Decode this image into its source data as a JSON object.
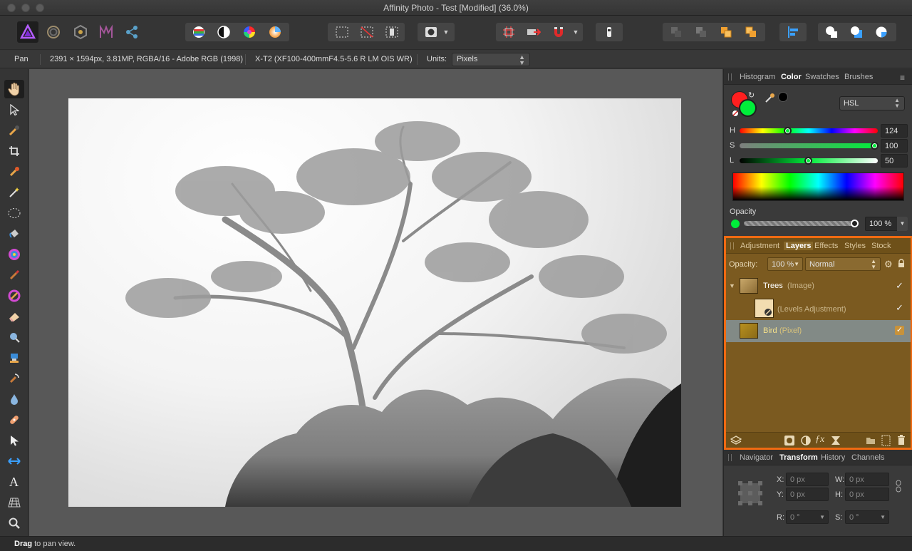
{
  "window": {
    "title": "Affinity Photo - Test [Modified] (36.0%)"
  },
  "personas": [
    "photo-persona-icon",
    "liquify-persona-icon",
    "develop-persona-icon",
    "tone-mapping-persona-icon",
    "export-persona-icon"
  ],
  "context": {
    "tool": "Pan",
    "doc_info": "2391 × 1594px, 3.81MP, RGBA/16 - Adobe RGB (1998)",
    "camera": "X-T2 (XF100-400mmF4.5-5.6 R LM OIS WR)",
    "units_label": "Units:",
    "units_value": "Pixels"
  },
  "status": {
    "bold": "Drag",
    "text": " to pan view."
  },
  "color_panel": {
    "tabs": [
      "Histogram",
      "Color",
      "Swatches",
      "Brushes"
    ],
    "active_tab": "Color",
    "model": "HSL",
    "h_label": "H",
    "h_value": "124",
    "s_label": "S",
    "s_value": "100",
    "l_label": "L",
    "l_value": "50",
    "opacity_label": "Opacity",
    "opacity_value": "100 %",
    "primary_color": "#ff1f1f",
    "secondary_color": "#00ee3a"
  },
  "layers_panel": {
    "tabs": [
      "Adjustment",
      "Layers",
      "Effects",
      "Styles",
      "Stock"
    ],
    "active_tab": "Layers",
    "opacity_label": "Opacity:",
    "opacity_value": "100 %",
    "blend_mode": "Normal",
    "layers": [
      {
        "name": "Trees",
        "type": "(Image)"
      },
      {
        "name": "",
        "type": "(Levels Adjustment)"
      },
      {
        "name": "Bird",
        "type": "(Pixel)"
      }
    ]
  },
  "transform_panel": {
    "tabs": [
      "Navigator",
      "Transform",
      "History",
      "Channels"
    ],
    "active_tab": "Transform",
    "x_label": "X:",
    "x_value": "0 px",
    "y_label": "Y:",
    "y_value": "0 px",
    "w_label": "W:",
    "w_value": "0 px",
    "h_label": "H:",
    "h_value": "0 px",
    "r_label": "R:",
    "r_value": "0 °",
    "s_label": "S:",
    "s_value": "0 °"
  }
}
